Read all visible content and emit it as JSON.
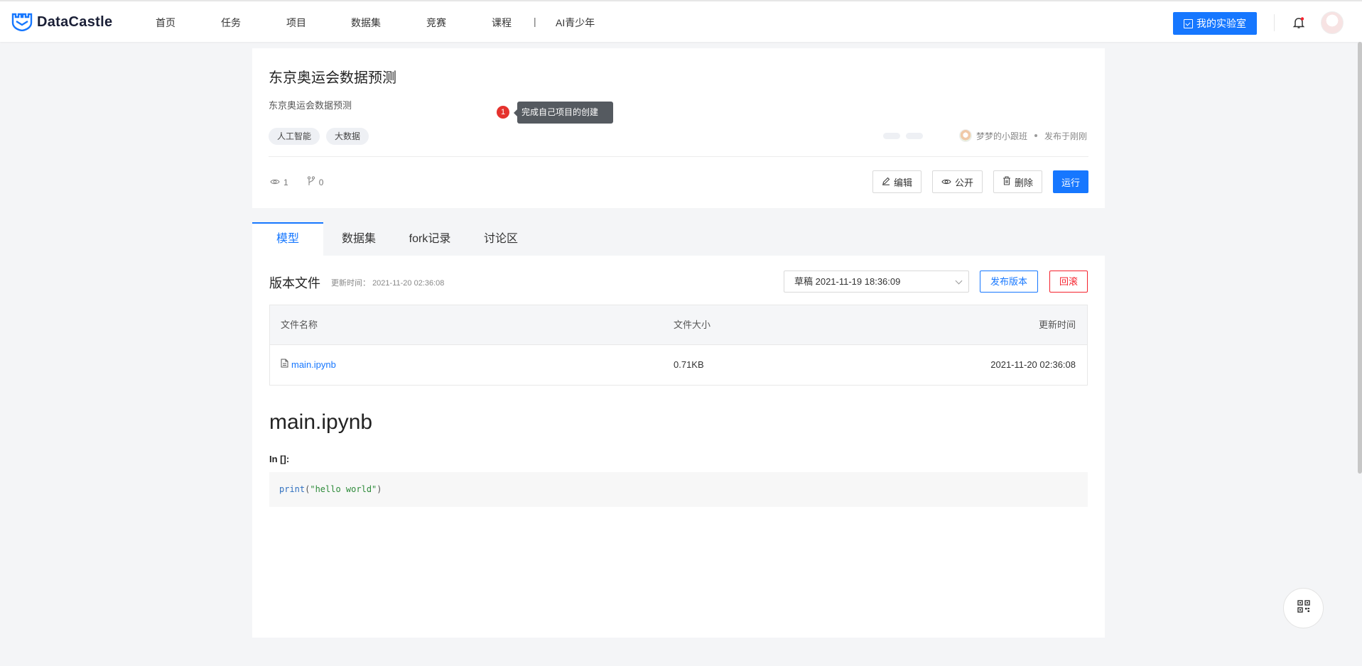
{
  "header": {
    "logo_text": "DataCastle",
    "nav": [
      "首页",
      "任务",
      "项目",
      "数据集",
      "竞赛",
      "课程"
    ],
    "nav_separator": "|",
    "nav_extra": "AI青少年",
    "lab_button": "我的实验室"
  },
  "project": {
    "title": "东京奥运会数据预测",
    "description": "东京奥运会数据预测",
    "tags": [
      "人工智能",
      "大数据"
    ],
    "author": "梦梦的小跟班",
    "published": "发布于刚刚",
    "views": "1",
    "forks": "0",
    "actions": {
      "edit": "编辑",
      "public": "公开",
      "delete": "删除",
      "run": "运行"
    }
  },
  "tooltip": {
    "badge": "1",
    "text": "完成自己项目的创建"
  },
  "tabs": [
    "模型",
    "数据集",
    "fork记录",
    "讨论区"
  ],
  "active_tab": "模型",
  "version": {
    "section_title": "版本文件",
    "update_label": "更新时间：",
    "update_time": "2021-11-20 02:36:08",
    "selected_version": "草稿 2021-11-19 18:36:09",
    "publish_button": "发布版本",
    "rollback_button": "回滚"
  },
  "file_table": {
    "columns": [
      "文件名称",
      "文件大小",
      "更新时间"
    ],
    "rows": [
      {
        "name": "main.ipynb",
        "size": "0.71KB",
        "updated": "2021-11-20 02:36:08"
      }
    ]
  },
  "notebook": {
    "title": "main.ipynb",
    "prompt": "In []:",
    "code_fn": "print",
    "code_open": "(",
    "code_str": "\"hello world\"",
    "code_close": ")"
  },
  "colors": {
    "primary": "#1677ff",
    "danger": "#f5222d",
    "badge": "#e5322d",
    "background": "#f4f5f7"
  },
  "icons": [
    "datacastle-logo-icon",
    "lab-icon",
    "bell-icon",
    "eye-icon",
    "fork-icon",
    "edit-icon",
    "trash-icon",
    "file-icon",
    "chevron-down-icon",
    "qrcode-icon"
  ]
}
